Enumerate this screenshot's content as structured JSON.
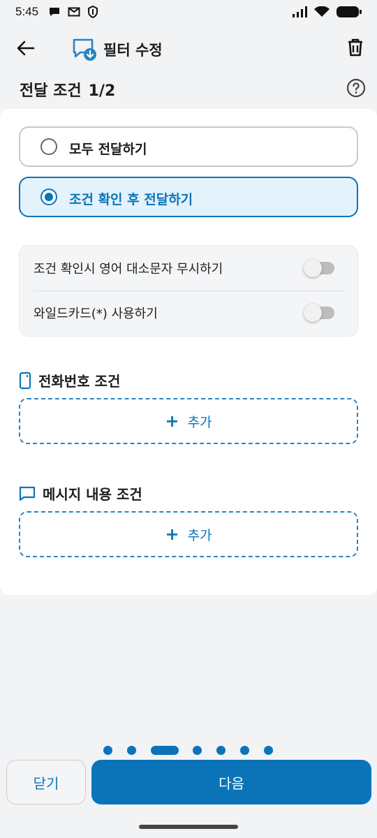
{
  "status_bar": {
    "time": "5:45",
    "left_icons": [
      "chat-bubble-icon",
      "mail-x-icon",
      "shield-icon"
    ],
    "right_icons": [
      "signal-icon",
      "wifi-icon",
      "battery-icon"
    ]
  },
  "app_bar": {
    "title": "필터 수정",
    "back_icon": "arrow-left-icon",
    "title_icon": "message-download-icon",
    "delete_icon": "trash-icon"
  },
  "step": {
    "title": "전달 조건",
    "counter": "1/2",
    "help_icon": "help-circle-icon"
  },
  "options": [
    {
      "label": "모두 전달하기",
      "selected": false
    },
    {
      "label": "조건 확인 후 전달하기",
      "selected": true
    }
  ],
  "settings": [
    {
      "label": "조건 확인시 영어 대소문자 무시하기",
      "on": false
    },
    {
      "label": "와일드카드(*) 사용하기",
      "on": false
    }
  ],
  "sections": {
    "phone": {
      "title": "전화번호 조건",
      "icon": "phone-icon",
      "add_label": "추가"
    },
    "message": {
      "title": "메시지 내용 조건",
      "icon": "message-icon",
      "add_label": "추가"
    }
  },
  "pager": {
    "total": 7,
    "active_index": 2
  },
  "footer": {
    "close_label": "닫기",
    "next_label": "다음"
  },
  "colors": {
    "accent": "#0b74b8",
    "selected_bg": "#e3f2fb",
    "background": "#f2f3f5"
  }
}
